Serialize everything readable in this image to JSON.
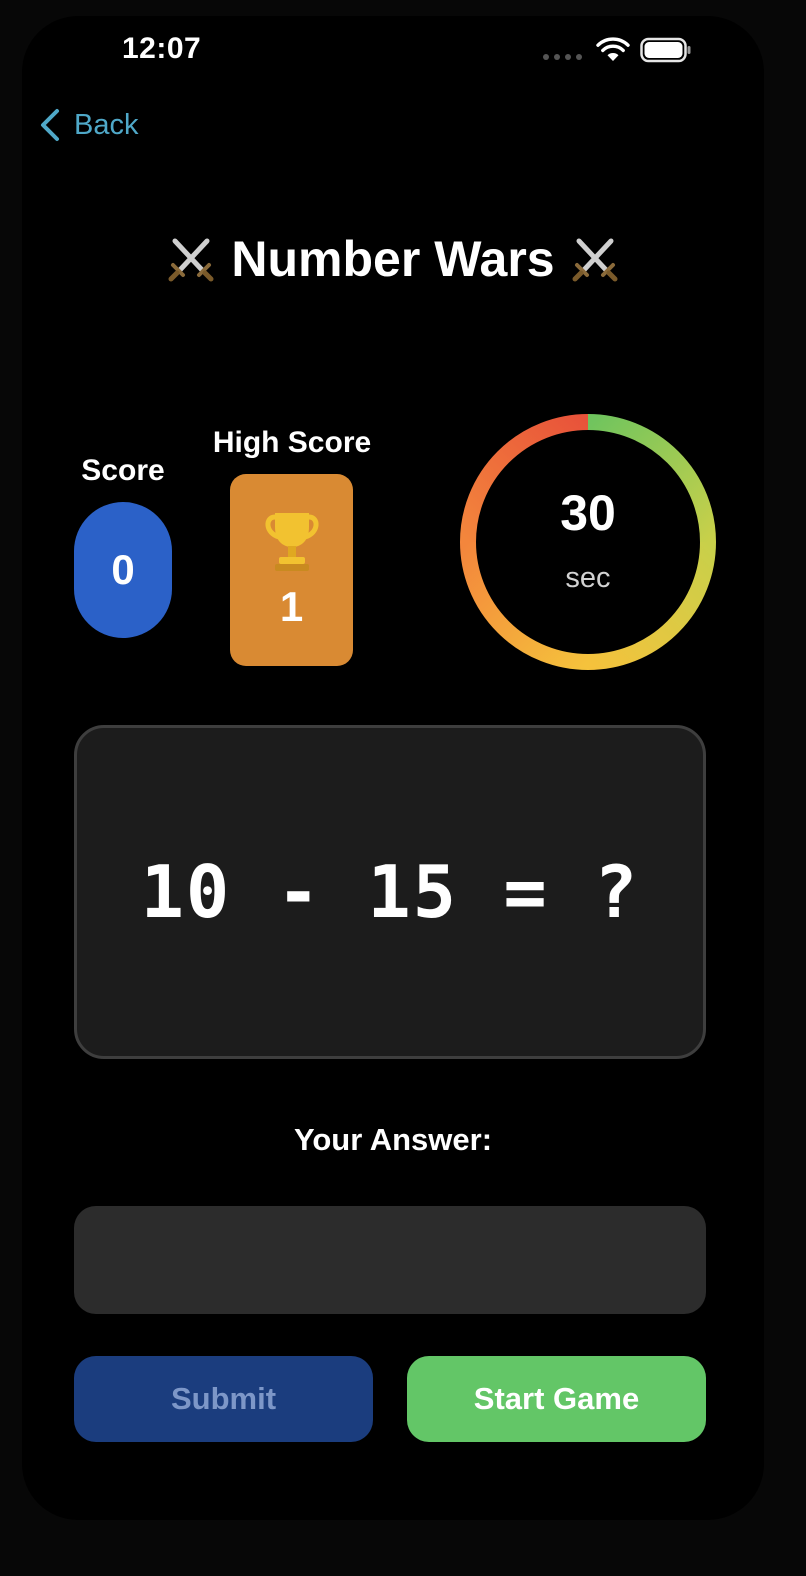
{
  "status_bar": {
    "time": "12:07"
  },
  "nav": {
    "back_label": "Back"
  },
  "title": {
    "text": "Number Wars",
    "left_icon": "crossed-swords-icon",
    "right_icon": "crossed-swords-icon",
    "emoji": "⚔️"
  },
  "score": {
    "label": "Score",
    "value": "0"
  },
  "high_score": {
    "label": "High Score",
    "value": "1",
    "icon": "trophy-icon"
  },
  "timer": {
    "value": "30",
    "unit": "sec",
    "remaining_fraction": 1.0
  },
  "question": {
    "text": "10 - 15 = ?"
  },
  "answer": {
    "label": "Your Answer:",
    "value": "",
    "placeholder": ""
  },
  "buttons": {
    "submit_label": "Submit",
    "start_label": "Start Game"
  },
  "colors": {
    "accent_blue": "#2b61c8",
    "high_score_orange": "#d98a33",
    "start_green": "#63c667",
    "submit_disabled": "#1b3d7e",
    "back_link": "#4fa8c8",
    "timer_gradient": [
      "#6fc45e",
      "#c8d04a",
      "#f5c23c",
      "#f3863c",
      "#e8523a"
    ]
  }
}
